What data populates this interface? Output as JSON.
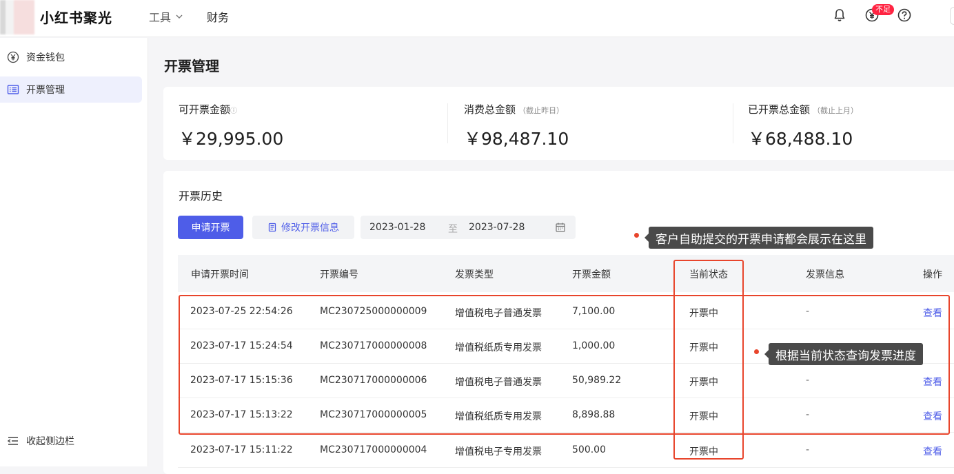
{
  "header": {
    "brand": "小红书聚光",
    "nav_tools": "工具",
    "nav_finance": "财务",
    "badge": "不足"
  },
  "sidebar": {
    "items": [
      {
        "label": "资金钱包",
        "icon": "yuan-circle-icon"
      },
      {
        "label": "开票管理",
        "icon": "invoice-list-icon"
      }
    ],
    "collapse_label": "收起侧边栏"
  },
  "page": {
    "title": "开票管理"
  },
  "summary": [
    {
      "label": "可开票金额",
      "note": "ⓘ",
      "sub": "",
      "value": "￥29,995.00"
    },
    {
      "label": "消费总金额",
      "note": "",
      "sub": "（截止昨日）",
      "value": "￥98,487.10"
    },
    {
      "label": "已开票总金额",
      "note": "",
      "sub": "（截止上月）",
      "value": "￥68,488.10"
    }
  ],
  "history": {
    "title": "开票历史",
    "apply_button": "申请开票",
    "edit_button": "修改开票信息",
    "date_start": "2023-01-28",
    "date_sep": "至",
    "date_end": "2023-07-28",
    "columns": [
      "申请开票时间",
      "开票编号",
      "发票类型",
      "开票金额",
      "当前状态",
      "发票信息",
      "操作"
    ],
    "rows": [
      [
        "2023-07-25 22:54:26",
        "MC230725000000009",
        "增值税电子普通发票",
        "7,100.00",
        "开票中",
        "-",
        "查看"
      ],
      [
        "2023-07-17 15:24:54",
        "MC230717000000008",
        "增值税纸质专用发票",
        "1,000.00",
        "开票中",
        "",
        ""
      ],
      [
        "2023-07-17 15:15:36",
        "MC230717000000006",
        "增值税电子普通发票",
        "50,989.22",
        "开票中",
        "-",
        "查看"
      ],
      [
        "2023-07-17 15:13:22",
        "MC230717000000005",
        "增值税纸质专用发票",
        "8,898.88",
        "开票中",
        "-",
        "查看"
      ],
      [
        "2023-07-17 15:11:22",
        "MC230717000000004",
        "增值税电子专用发票",
        "500.00",
        "开票中",
        "-",
        "查看"
      ]
    ]
  },
  "annotations": {
    "tip1": "客户自助提交的开票申请都会展示在这里",
    "tip2": "根据当前状态查询发票进度",
    "color": "#e8452c"
  }
}
